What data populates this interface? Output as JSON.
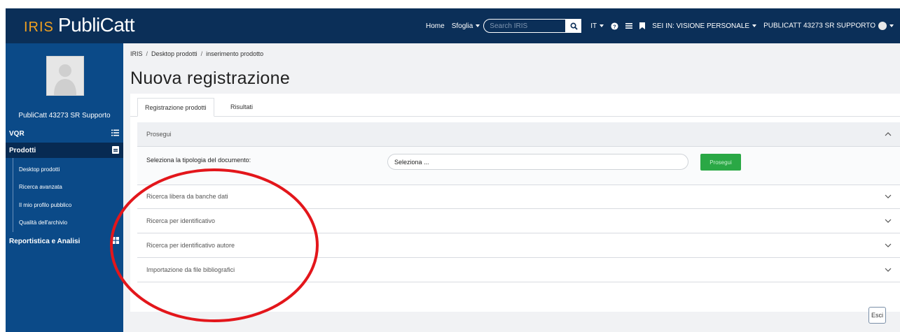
{
  "navbar": {
    "logo_prefix": "IRIS",
    "logo_text": "PubliCatt",
    "home": "Home",
    "sfoglia": "Sfoglia",
    "search_placeholder": "Search IRIS",
    "lang": "IT",
    "visione": "SEI IN: VISIONE PERSONALE",
    "user": "PUBLICATT 43273 SR SUPPORTO"
  },
  "sidebar": {
    "profile_name": "PubliCatt 43273 SR  Supporto",
    "items": [
      {
        "label": "VQR",
        "icon": "list-ordered-icon"
      },
      {
        "label": "Prodotti",
        "icon": "book-icon"
      },
      {
        "label": "Reportistica e Analisi",
        "icon": "table-icon"
      }
    ],
    "subitems": [
      "Desktop prodotti",
      "Ricerca avanzata",
      "Il mio profilo pubblico",
      "Qualità dell'archivio"
    ]
  },
  "breadcrumb": [
    "IRIS",
    "Desktop prodotti",
    "inserimento prodotto"
  ],
  "page_title": "Nuova registrazione",
  "tabs": [
    "Registrazione prodotti",
    "Risultati"
  ],
  "accordion": {
    "open_section": {
      "title": "Prosegui",
      "field_label": "Seleziona la tipologia del documento:",
      "select_value": "Seleziona ...",
      "button_label": "Prosegui"
    },
    "collapsed": [
      "Ricerca libera da banche dati",
      "Ricerca per identificativo",
      "Ricerca per identificativo autore",
      "Importazione da file bibliografici"
    ]
  },
  "esci_label": "Esci",
  "colors": {
    "navbar": "#0b2f58",
    "sidebar": "#0b4a88",
    "accent": "#2aa845",
    "annotation": "#e3161b"
  }
}
